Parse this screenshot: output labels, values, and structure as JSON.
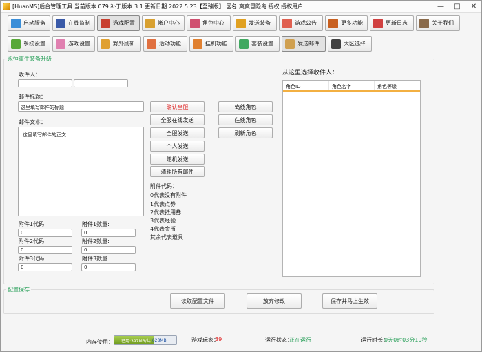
{
  "title": "[HuanMS]后台管理工具 当前版本:079 补丁版本:3.1 更新日期:2022.5.23【至臻版】 区名:爽爽冒险岛 授权:授权用户",
  "window_buttons": [
    "—",
    "□",
    "✕"
  ],
  "toolbar1": [
    {
      "label": "启动服务",
      "icon": "server-icon",
      "color": "#3a8ed8"
    },
    {
      "label": "在线监制",
      "icon": "monitor-icon",
      "color": "#3a5aa8"
    },
    {
      "label": "游戏配置",
      "icon": "config-icon",
      "color": "#c84030",
      "active": true
    },
    {
      "label": "帐户中心",
      "icon": "account-icon",
      "color": "#d8a030"
    },
    {
      "label": "角色中心",
      "icon": "character-icon",
      "color": "#d05070"
    },
    {
      "label": "发送装备",
      "icon": "equipment-icon",
      "color": "#e0a020"
    },
    {
      "label": "游戏公告",
      "icon": "notice-icon",
      "color": "#e06050"
    },
    {
      "label": "更多功能",
      "icon": "more-icon",
      "color": "#c86020"
    },
    {
      "label": "更新日志",
      "icon": "log-icon",
      "color": "#d04040"
    },
    {
      "label": "关于我们",
      "icon": "about-icon",
      "color": "#8a6a4a"
    }
  ],
  "toolbar2": [
    {
      "label": "系统设置",
      "icon": "system-icon",
      "color": "#58a838"
    },
    {
      "label": "游戏设置",
      "icon": "game-icon",
      "color": "#e080b0"
    },
    {
      "label": "野外刷新",
      "icon": "refresh-icon",
      "color": "#e0a030"
    },
    {
      "label": "活动功能",
      "icon": "activity-icon",
      "color": "#e07040"
    },
    {
      "label": "挂机功能",
      "icon": "idle-icon",
      "color": "#e08030"
    },
    {
      "label": "套装设置",
      "icon": "suit-icon",
      "color": "#40a860"
    },
    {
      "label": "发送邮件",
      "icon": "mail-icon",
      "color": "#d0a050",
      "active": true
    },
    {
      "label": "大区选择",
      "icon": "region-icon",
      "color": "#404040"
    }
  ],
  "mail_group_title": "永恒重生装备升级",
  "recipient_label": "收件人：",
  "subject_label": "邮件标题：",
  "subject_value": "这里填写邮件的标题",
  "body_label": "邮件文本：",
  "body_value": "这里填写邮件的正文",
  "actions": [
    "确认全服",
    "全服在线发送",
    "全服发送",
    "个人发送",
    "随机发送",
    "清理所有邮件"
  ],
  "role_buttons": [
    "离线角色",
    "在线角色",
    "刷新角色"
  ],
  "attach_title": "附件代码：",
  "attach_codes": [
    "0代表没有附件",
    "1代表点劵",
    "2代表抵用券",
    "3代表经验",
    "4代表金币",
    "其余代表道具"
  ],
  "attachments": [
    {
      "code_label": "附件1代码:",
      "code_value": "0",
      "qty_label": "附件1数量:",
      "qty_value": "0"
    },
    {
      "code_label": "附件2代码:",
      "code_value": "0",
      "qty_label": "附件2数量:",
      "qty_value": "0"
    },
    {
      "code_label": "附件3代码:",
      "code_value": "0",
      "qty_label": "附件3数量:",
      "qty_value": "0"
    }
  ],
  "select_label": "从这里选择收件人：",
  "columns": [
    "角色ID",
    "角色名字",
    "角色等级"
  ],
  "config_group_title": "配置保存",
  "config_buttons": [
    "读取配置文件",
    "放弃修改",
    "保存并马上生效"
  ],
  "status": {
    "mem_label": "内存使用：",
    "mem_used": "已用:397MB/共:",
    "mem_total": "628MB",
    "mem_fraction": 0.63,
    "players_label": "游戏玩家：",
    "players_value": "39",
    "run_label": "运行状态：",
    "run_value": "正在运行",
    "uptime_label": "运行时长：",
    "uptime_value": "0天0时03分19秒"
  },
  "colors": {
    "accent_green": "#2aa05a",
    "red": "#e02020",
    "highlight": "#f3b042"
  }
}
